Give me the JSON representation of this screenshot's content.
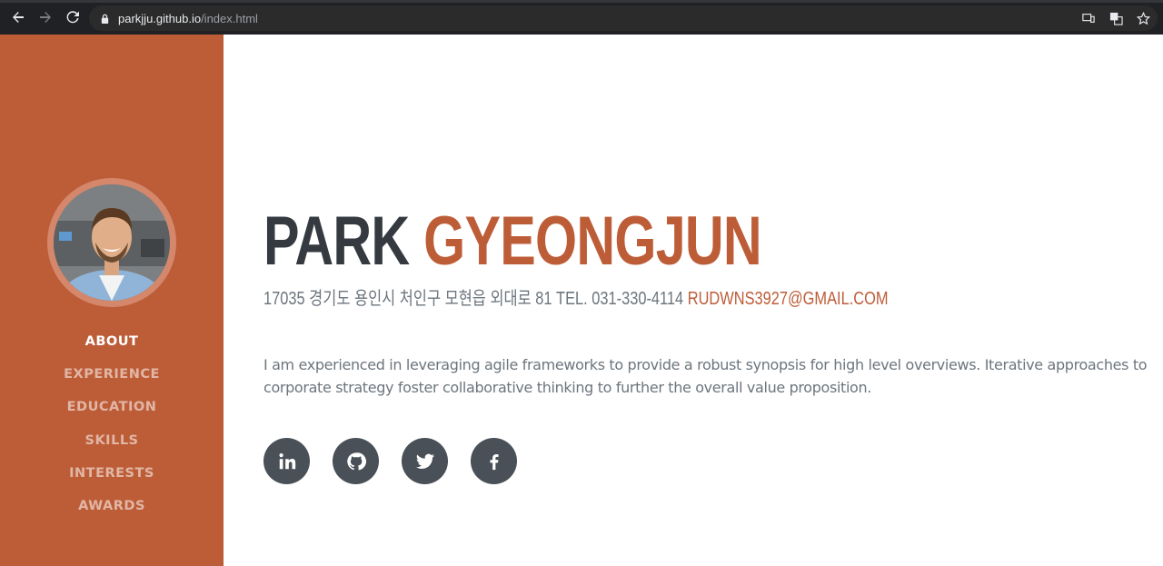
{
  "browser": {
    "url_host": "parkjju.github.io",
    "url_path": "/index.html"
  },
  "sidebar": {
    "items": [
      {
        "label": "ABOUT",
        "active": true
      },
      {
        "label": "EXPERIENCE"
      },
      {
        "label": "EDUCATION"
      },
      {
        "label": "SKILLS"
      },
      {
        "label": "INTERESTS"
      },
      {
        "label": "AWARDS"
      }
    ]
  },
  "about": {
    "first_name": "PARK",
    "last_name": "GYEONGJUN",
    "address": "17035 경기도 용인시 처인구 모현읍 외대로 81 TEL. 031-330-4114",
    "email": "RUDWNS3927@GMAIL.COM",
    "lead": "I am experienced in leveraging agile frameworks to provide a robust synopsis for high level overviews. Iterative approaches to corporate strategy foster collaborative thinking to further the overall value proposition."
  },
  "social": [
    {
      "icon": "linkedin-icon"
    },
    {
      "icon": "github-icon"
    },
    {
      "icon": "twitter-icon"
    },
    {
      "icon": "facebook-icon"
    }
  ],
  "colors": {
    "primary": "#bd5d38",
    "dark": "#343a40",
    "muted": "#6c757d",
    "social_bg": "#495057"
  }
}
